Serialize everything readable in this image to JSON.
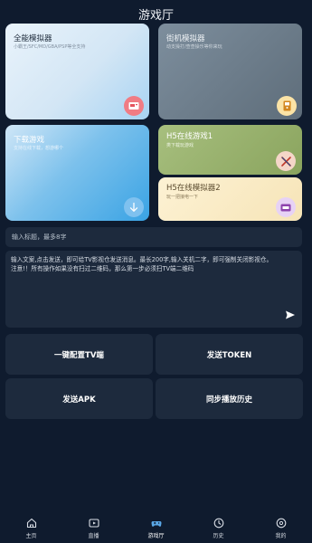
{
  "header": {
    "title": "游戏厅"
  },
  "cards": {
    "all_emulator": {
      "title": "全能模拟器",
      "subtitle": "小霸王/SFC/MD/GBA/PSP等全支持"
    },
    "arcade_emulator": {
      "title": "街机模拟器",
      "subtitle": "动支操打/查查操乐等你来玩"
    },
    "download_games": {
      "title": "下载游戏",
      "subtitle": "支持在线下载，想游哪个"
    },
    "h5_online_game": {
      "title": "H5在线游戏1",
      "subtitle": "类下载玩游戏"
    },
    "h5_online_emulator": {
      "title": "H5在线模拟器2",
      "subtitle": "玩一把接电一下"
    }
  },
  "form": {
    "title_placeholder": "输入标题，最多8字",
    "message_text": "输入文案,点击发送，即可给TV影视仓发送消息。最长200字,输入关机二字，即可强制关闭影视仓。\n注意!！所有操作如果没有扫过二维码，那么第一步必须扫TV端二维码"
  },
  "actions": {
    "configure_tv": "一键配置TV端",
    "send_token": "发送TOKEN",
    "send_apk": "发送APK",
    "sync_history": "同步播放历史"
  },
  "nav": [
    {
      "label": "主页",
      "icon": "home-icon"
    },
    {
      "label": "直播",
      "icon": "live-tv-icon"
    },
    {
      "label": "游戏厅",
      "icon": "gamepad-icon",
      "active": true
    },
    {
      "label": "历史",
      "icon": "clock-icon"
    },
    {
      "label": "我的",
      "icon": "profile-icon"
    }
  ],
  "colors": {
    "background": "#0f1b2e",
    "panel": "#1d2a3d",
    "accent_blue": "#3aa3e4"
  }
}
